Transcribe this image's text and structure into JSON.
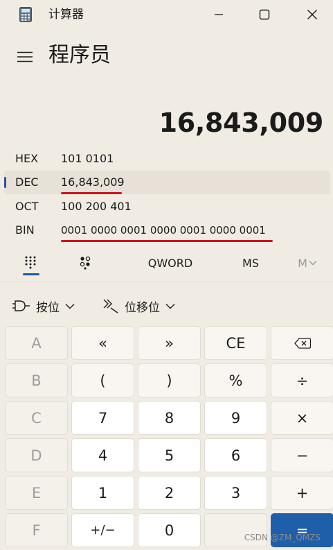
{
  "window": {
    "title": "计算器",
    "icon": "calculator-icon",
    "controls": [
      "minimize-icon",
      "maximize-icon",
      "close-icon"
    ]
  },
  "header": {
    "menu_icon": "hamburger-menu-icon",
    "mode_title": "程序员"
  },
  "display": {
    "value": "16,843,009"
  },
  "radix": [
    {
      "label": "HEX",
      "value": "101 0101",
      "selected": false
    },
    {
      "label": "DEC",
      "value": "16,843,009",
      "selected": true
    },
    {
      "label": "OCT",
      "value": "100 200 401",
      "selected": false
    },
    {
      "label": "BIN",
      "value": "0001 0000 0001 0000 0001 0000 0001",
      "selected": false
    }
  ],
  "keypad_modes": {
    "full_keypad_icon": "full-keypad-icon",
    "bit_toggle_icon": "bit-toggle-keypad-icon",
    "word_size": "QWORD",
    "memory_store": "MS",
    "memory_list": "M"
  },
  "operators": {
    "bitwise_label": "按位",
    "bitshift_label": "位移位"
  },
  "keys": [
    [
      "A",
      "«",
      "»",
      "CE",
      "backspace-icon"
    ],
    [
      "B",
      "(",
      ")",
      "%",
      "÷"
    ],
    [
      "C",
      "7",
      "8",
      "9",
      "×"
    ],
    [
      "D",
      "4",
      "5",
      "6",
      "−"
    ],
    [
      "E",
      "1",
      "2",
      "3",
      "+"
    ],
    [
      "F",
      "+/−",
      "0",
      "",
      "="
    ]
  ],
  "watermark": "CSDN @ZM_QMZS",
  "colors": {
    "background": "#f1ece3",
    "accent": "#1f5ea8",
    "selection_bar": "#1f57a6",
    "annotation_red": "#d0121b"
  }
}
